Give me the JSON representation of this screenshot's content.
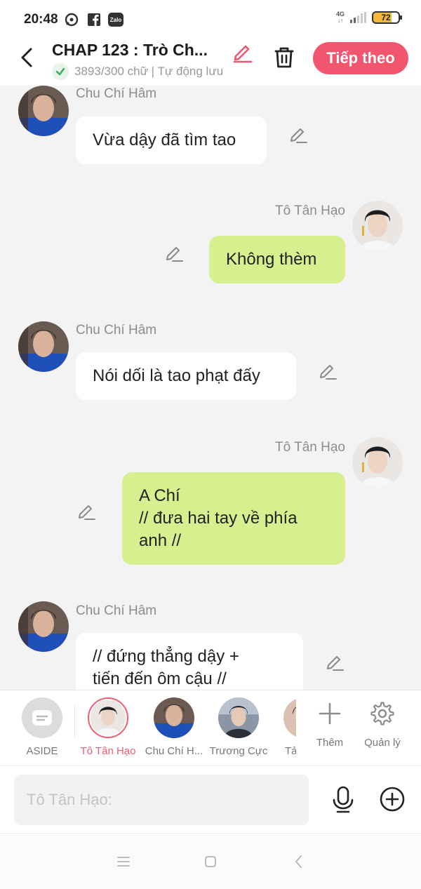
{
  "statusbar": {
    "time": "20:48",
    "network": "4G",
    "battery": "72",
    "icons": [
      "messenger-icon",
      "facebook-icon",
      "zalo-icon"
    ],
    "zalo_label": "Zalo"
  },
  "header": {
    "title": "CHAP 123 : Trò Ch...",
    "word_count": "3893/300 chữ | Tự động lưu",
    "next_label": "Tiếp theo",
    "accent_color": "#f2566f"
  },
  "messages": [
    {
      "sender": "Chu Chí Hâm",
      "side": "left",
      "text": "Vừa dậy đã tìm tao"
    },
    {
      "sender": "Tô Tân Hạo",
      "side": "right",
      "text": "Không thèm"
    },
    {
      "sender": "Chu Chí Hâm",
      "side": "left",
      "text": "Nói dối là tao phạt đấy"
    },
    {
      "sender": "Tô Tân Hạo",
      "side": "right",
      "text": "A Chí\n// đưa hai tay về phía\nanh //"
    },
    {
      "sender": "Chu Chí Hâm",
      "side": "left",
      "text": "// đứng thẳng dậy +\ntiến đến ôm cậu //"
    }
  ],
  "cast": {
    "items": [
      {
        "label": "ASIDE"
      },
      {
        "label": "Tô Tân Hạo",
        "active": true
      },
      {
        "label": "Chu Chí H..."
      },
      {
        "label": "Trương Cực"
      },
      {
        "label": "Tả"
      }
    ],
    "add_label": "Thêm",
    "manage_label": "Quản lý"
  },
  "input": {
    "placeholder": "Tô Tân Hạo:"
  }
}
